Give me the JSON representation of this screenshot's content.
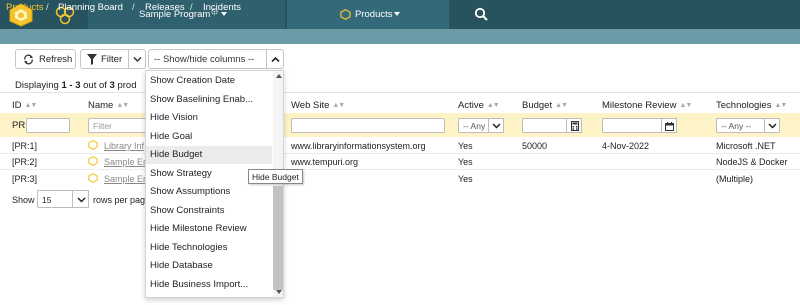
{
  "colors": {
    "topbar": "#27535f",
    "navbar": "#6a9ba7",
    "accent": "#f5c431",
    "filter_row": "#fdf3c6"
  },
  "topbar": {
    "program_label": "Sample Program",
    "products_label": "Products",
    "icons": [
      "logo-icon",
      "links-icon",
      "gear-icon",
      "search-icon"
    ]
  },
  "breadcrumb": [
    "Products",
    "Planning Board",
    "Releases",
    "Incidents"
  ],
  "toolbar": {
    "refresh_label": "Refresh",
    "filter_label": "Filter",
    "columns_label": "-- Show/hide columns --"
  },
  "displaying": {
    "prefix": "Displaying ",
    "range": "1 - 3",
    "mid": " out of ",
    "total": "3",
    "suffix": " prod"
  },
  "columns": {
    "id": "ID",
    "name": "Name",
    "website": "Web Site",
    "active": "Active",
    "budget": "Budget",
    "milestone": "Milestone Review",
    "technologies": "Technologies"
  },
  "filters": {
    "id_prefix": "PR",
    "name_placeholder": "Filter",
    "active_value": "-- Any --",
    "tech_value": "-- Any --"
  },
  "rows": [
    {
      "id": "[PR:1]",
      "name": "Library Inf",
      "website": "www.libraryinformationsystem.org",
      "active": "Yes",
      "budget": "50000",
      "milestone": "4-Nov-2022",
      "technologies": "Microsoft .NET"
    },
    {
      "id": "[PR:2]",
      "name": "Sample Er",
      "website": "www.tempuri.org",
      "active": "Yes",
      "budget": "",
      "milestone": "",
      "technologies": "NodeJS & Docker"
    },
    {
      "id": "[PR:3]",
      "name": "Sample Er",
      "website": "",
      "active": "Yes",
      "budget": "",
      "milestone": "",
      "technologies": "(Multiple)"
    }
  ],
  "pagination": {
    "show_label": "Show",
    "page_size": "15",
    "suffix": "rows per pag"
  },
  "dropdown": {
    "items": [
      "Show Creation Date",
      "Show Baselining Enab...",
      "Hide Vision",
      "Hide Goal",
      "Hide Budget",
      "Show Strategy",
      "Show Assumptions",
      "Show Constraints",
      "Hide Milestone Review",
      "Hide Technologies",
      "Hide Database",
      "Hide Business Import..."
    ],
    "hovered": "Hide Budget",
    "tooltip": "Hide Budget"
  }
}
